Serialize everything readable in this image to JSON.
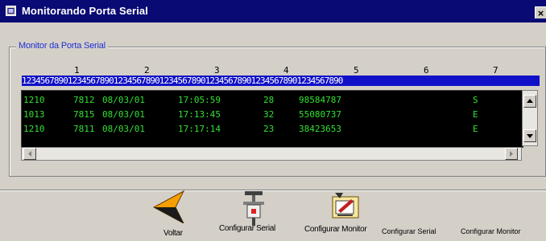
{
  "window": {
    "title": "Monitorando Porta Serial",
    "close_glyph": "×"
  },
  "group": {
    "label": "Monitor da Porta Serial"
  },
  "ruler": {
    "tens": [
      "1",
      "2",
      "3",
      "4",
      "5",
      "6",
      "7"
    ],
    "digits": "1234567890123456789012345678901234567890123456789012345678901234567890"
  },
  "records": [
    {
      "c1": "1210",
      "c2": "7812",
      "date": "08/03/01",
      "time": "17:05:59",
      "c5": "28",
      "c6": "98584787",
      "flag": "S"
    },
    {
      "c1": "1013",
      "c2": "7815",
      "date": "08/03/01",
      "time": "17:13:45",
      "c5": "32",
      "c6": "55080737",
      "flag": "E"
    },
    {
      "c1": "1210",
      "c2": "7811",
      "date": "08/03/01",
      "time": "17:17:14",
      "c5": "23",
      "c6": "38423653",
      "flag": "E"
    }
  ],
  "toolbar": {
    "back_label": "Voltar",
    "config_serial_label": "Configurar Serial",
    "config_monitor_label": "Configurar Monitor"
  },
  "status": {
    "left": "",
    "hint_a": "Configurar Serial",
    "hint_b": "Configurar Monitor"
  },
  "icons": {
    "title": "window-app-icon",
    "back": "arrow-left-icon",
    "serial": "serial-connector-icon",
    "monitor": "monitor-settings-icon"
  }
}
